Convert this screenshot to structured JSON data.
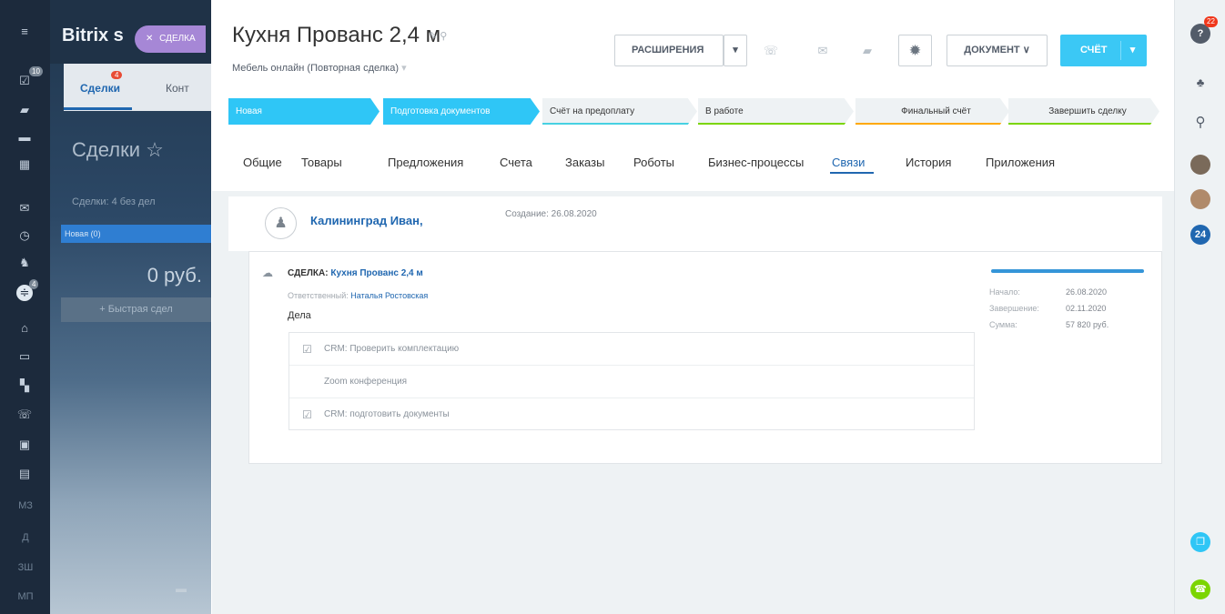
{
  "rail": {
    "badge_notifications": "10",
    "badge_small": "4",
    "bottom_labels": [
      "МЗ",
      "Д",
      "ЗШ",
      "МП"
    ]
  },
  "list": {
    "brand": "Bitrix s",
    "close_label": "СДЕЛКА",
    "tab_deals": "Сделки",
    "tab_deals_badge": "4",
    "tab_contacts": "Конт",
    "title": "Сделки ☆",
    "counter": "Сделки: 4 без дел",
    "stage_new": "Новая (0)",
    "sum": "0 руб.",
    "quick_deal": "+ Быстрая сдел"
  },
  "header": {
    "title": "Кухня Прованс 2,4  м",
    "subtitle": "Мебель онлайн (Повторная сделка)",
    "btn_extensions": "РАСШИРЕНИЯ",
    "btn_document": "ДОКУМЕНТ ∨",
    "btn_invoice": "СЧЁТ"
  },
  "stages": [
    {
      "label": "Новая"
    },
    {
      "label": "Подготовка документов"
    },
    {
      "label": "Счёт на предоплату"
    },
    {
      "label": "В работе"
    },
    {
      "label": "Финальный счёт"
    },
    {
      "label": "Завершить сделку"
    }
  ],
  "tabs": [
    "Общие",
    "Товары",
    "Предложения",
    "Счета",
    "Заказы",
    "Роботы",
    "Бизнес-процессы",
    "Связи",
    "История",
    "Приложения"
  ],
  "active_tab": "Связи",
  "contact": {
    "name": "Калининград Иван,",
    "created": "Создание: 26.08.2020"
  },
  "deal": {
    "prefix": "СДЕЛКА:",
    "name": "Кухня Прованс 2,4 м",
    "responsible_label": "Ответственный:",
    "responsible": "Наталья Ростовская",
    "tasks_title": "Дела",
    "tasks": [
      {
        "text": "CRM: Проверить комплектацию",
        "checkbox": true
      },
      {
        "text": "Zoom конференция",
        "checkbox": false
      },
      {
        "text": "CRM: подготовить документы",
        "checkbox": true
      }
    ],
    "meta": [
      {
        "label": "Начало:",
        "value": "26.08.2020"
      },
      {
        "label": "Завершение:",
        "value": "02.11.2020"
      },
      {
        "label": "Сумма:",
        "value": "57 820 руб."
      }
    ],
    "progress": 1.0
  },
  "right_rail": {
    "help_badge": "22",
    "bitrix24": "24"
  },
  "colors": {
    "accent": "#3bc8f5",
    "link": "#2067b0",
    "stage_active": "#2fc6f6"
  }
}
